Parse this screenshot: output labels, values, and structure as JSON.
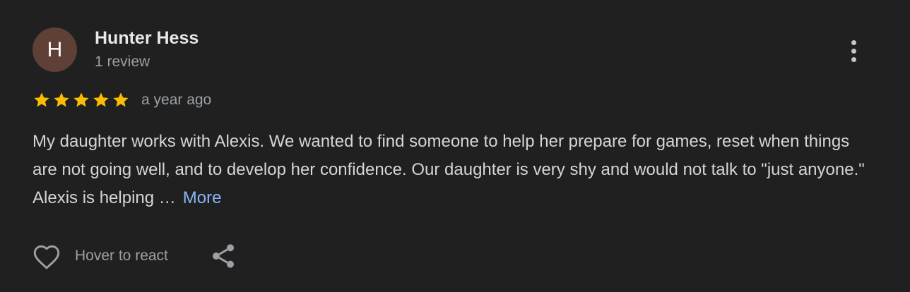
{
  "author": {
    "initial": "H",
    "name": "Hunter Hess",
    "meta": "1 review",
    "avatar_color": "#5e4036"
  },
  "review": {
    "rating": 5,
    "rating_max": 5,
    "timestamp": "a year ago",
    "text": "My daughter works with Alexis. We wanted to find someone to help her prepare for games, reset when things are not going well, and to develop her confidence. Our daughter is very shy and would not talk to \"just anyone.\" Alexis is helping …",
    "more_label": "More"
  },
  "actions": {
    "react_label": "Hover to react"
  },
  "icons": {
    "menu": "more-vert-icon",
    "star": "star-icon",
    "react": "heart-icon",
    "share": "share-icon"
  },
  "colors": {
    "background": "#202020",
    "star": "#fbbc04",
    "link": "#8ab4f8"
  }
}
